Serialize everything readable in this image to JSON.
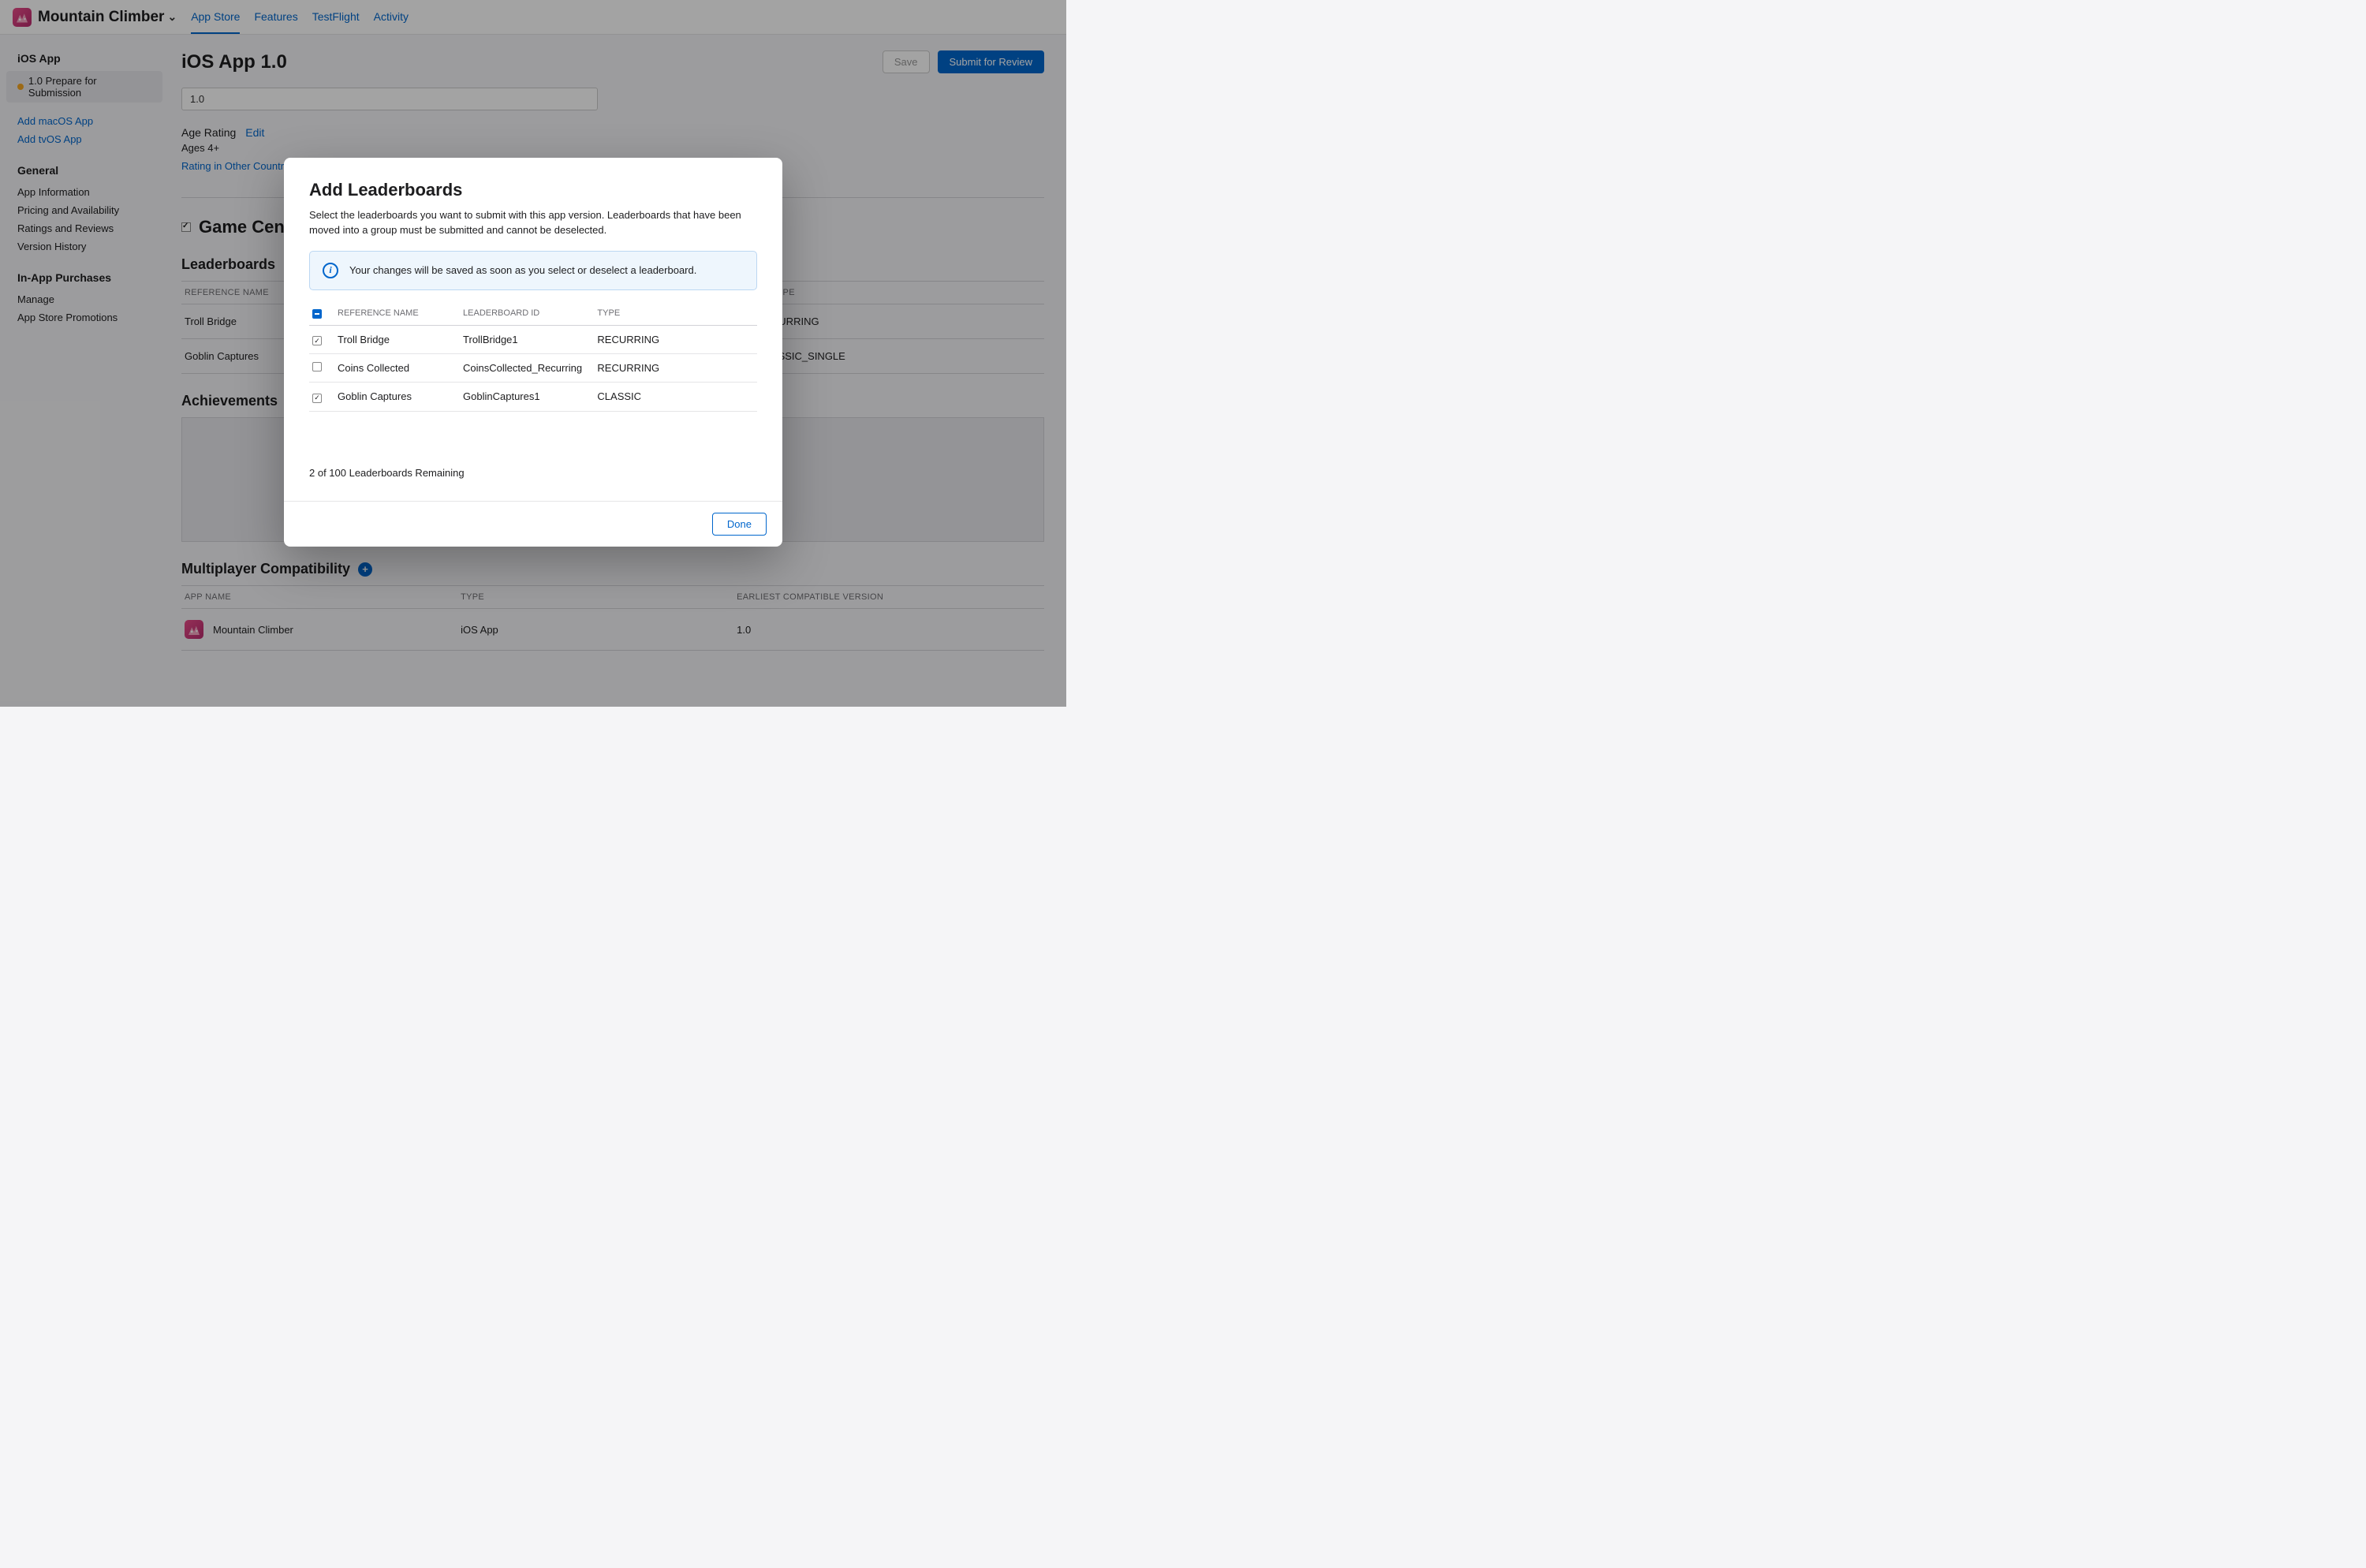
{
  "header": {
    "app_name": "Mountain Climber",
    "tabs": [
      "App Store",
      "Features",
      "TestFlight",
      "Activity"
    ],
    "active_tab": 0
  },
  "sidebar": {
    "platform_heading": "iOS App",
    "version_label": "1.0 Prepare for Submission",
    "add_links": [
      "Add macOS App",
      "Add tvOS App"
    ],
    "general_heading": "General",
    "general_items": [
      "App Information",
      "Pricing and Availability",
      "Ratings and Reviews",
      "Version History"
    ],
    "iap_heading": "In-App Purchases",
    "iap_items": [
      "Manage",
      "App Store Promotions"
    ]
  },
  "main": {
    "title": "iOS App 1.0",
    "save_label": "Save",
    "submit_label": "Submit for Review",
    "version_value": "1.0",
    "age_rating_label": "Age Rating",
    "edit_label": "Edit",
    "age_value": "Ages 4+",
    "rating_countries_link": "Rating in Other Countri",
    "game_center_heading": "Game Center",
    "leaderboards_heading": "Leaderboards",
    "lb_columns": {
      "ref": "REFERENCE NAME",
      "type": "TYPE"
    },
    "lb_rows": [
      {
        "ref": "Troll Bridge",
        "type": "CURRING"
      },
      {
        "ref": "Goblin Captures",
        "type": "ASSIC_SINGLE"
      }
    ],
    "achievements_heading": "Achievements",
    "multiplayer_heading": "Multiplayer Compatibility",
    "mp_columns": {
      "app": "APP NAME",
      "type": "TYPE",
      "ver": "EARLIEST COMPATIBLE VERSION"
    },
    "mp_row": {
      "app": "Mountain Climber",
      "type": "iOS App",
      "ver": "1.0"
    }
  },
  "modal": {
    "title": "Add Leaderboards",
    "desc": "Select the leaderboards you want to submit with this app version. Leaderboards that have been moved into a group must be submitted and cannot be deselected.",
    "info": "Your changes will be saved as soon as you select or deselect a leaderboard.",
    "columns": {
      "ref": "REFERENCE NAME",
      "id": "LEADERBOARD ID",
      "type": "TYPE"
    },
    "rows": [
      {
        "checked": true,
        "ref": "Troll Bridge",
        "id": "TrollBridge1",
        "type": "RECURRING"
      },
      {
        "checked": false,
        "ref": "Coins Collected",
        "id": "CoinsCollected_Recurring",
        "type": "RECURRING"
      },
      {
        "checked": true,
        "ref": "Goblin Captures",
        "id": "GoblinCaptures1",
        "type": "CLASSIC"
      }
    ],
    "remaining": "2 of 100 Leaderboards Remaining",
    "done_label": "Done"
  }
}
